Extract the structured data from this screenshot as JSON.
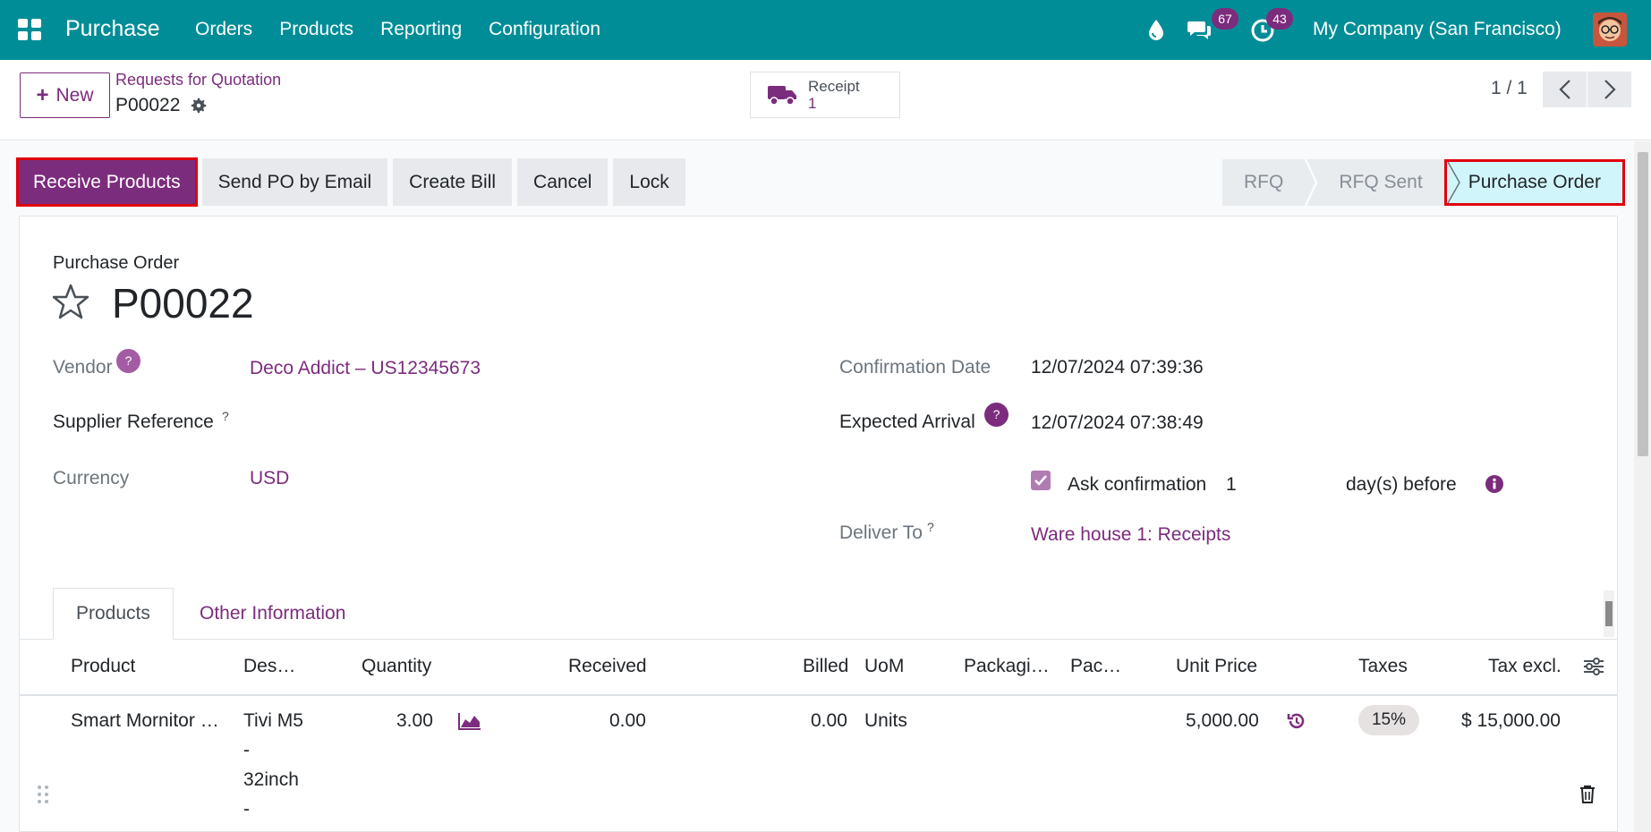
{
  "navbar": {
    "brand": "Purchase",
    "menu": [
      "Orders",
      "Products",
      "Reporting",
      "Configuration"
    ],
    "messages_count": "67",
    "activities_count": "43",
    "company": "My Company (San Francisco)"
  },
  "control": {
    "new_label": "New",
    "breadcrumb": "Requests for Quotation",
    "record": "P00022",
    "receipt_label": "Receipt",
    "receipt_count": "1",
    "pager": "1 / 1"
  },
  "statusbar": {
    "buttons": [
      "Receive Products",
      "Send PO by Email",
      "Create Bill",
      "Cancel",
      "Lock"
    ],
    "stages": [
      "RFQ",
      "RFQ Sent",
      "Purchase Order"
    ],
    "active_stage": "Purchase Order"
  },
  "form": {
    "heading_small": "Purchase Order",
    "name": "P00022",
    "vendor_label": "Vendor",
    "vendor_value": "Deco Addict – US12345673",
    "supplier_ref_label": "Supplier Reference",
    "currency_label": "Currency",
    "currency_value": "USD",
    "confirmation_date_label": "Confirmation Date",
    "confirmation_date_value": "12/07/2024 07:39:36",
    "expected_arrival_label": "Expected Arrival",
    "expected_arrival_value": "12/07/2024 07:38:49",
    "ask_confirmation_label": "Ask confirmation",
    "ask_confirmation_days": "1",
    "days_before": "day(s) before",
    "deliver_to_label": "Deliver To",
    "deliver_to_value": "Ware house 1: Receipts",
    "help_mark": "?",
    "sup_mark": "?"
  },
  "tabs": [
    "Products",
    "Other Information"
  ],
  "table": {
    "columns": [
      "Product",
      "Des…",
      "Quantity",
      "Received",
      "Billed",
      "UoM",
      "Packagi…",
      "Pac…",
      "Unit Price",
      "Taxes",
      "Tax excl."
    ],
    "row": {
      "product": "Smart Mornitor …",
      "description_lines": [
        "Tivi M5",
        "-",
        "32inch",
        "-"
      ],
      "quantity": "3.00",
      "received": "0.00",
      "billed": "0.00",
      "uom": "Units",
      "unit_price": "5,000.00",
      "tax": "15%",
      "subtotal": "$ 15,000.00"
    }
  },
  "colors": {
    "navbar": "#018d97",
    "primary": "#7c2c7d",
    "highlight": "#e0000d",
    "active_stage": "#d0f6fb"
  }
}
